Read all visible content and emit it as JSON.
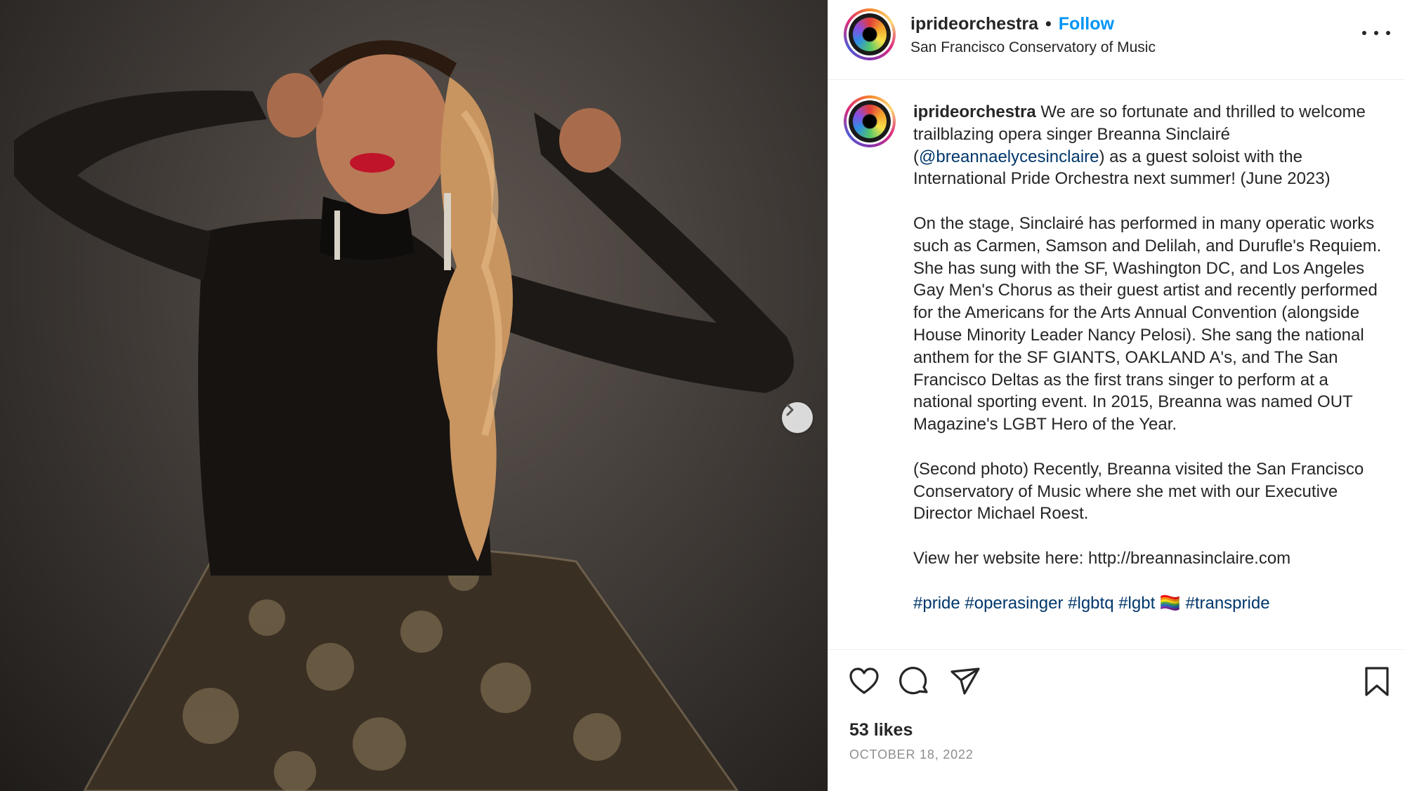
{
  "post": {
    "username": "iprideorchestra",
    "follow_label": "Follow",
    "location": "San Francisco Conservatory of Music",
    "caption": {
      "username": "iprideorchestra",
      "p1_a": "We are so fortunate and thrilled to welcome trailblazing opera singer Breanna Sinclairé (",
      "p1_mention": "@breannaelycesinclaire",
      "p1_b": ") as a guest soloist with the International Pride Orchestra next summer! (June 2023)",
      "p2": "On the stage, Sinclairé has performed in many operatic works such as Carmen, Samson and Delilah, and Durufle's Requiem. She has sung with the SF, Washington DC, and Los Angeles  Gay Men's Chorus as their guest artist and recently performed for the Americans for the Arts Annual Convention (alongside House Minority Leader Nancy Pelosi). She sang the national anthem for the SF GIANTS, OAKLAND A's, and The San Francisco Deltas as the first trans singer to perform at a national sporting event. In 2015, Breanna was named OUT Magazine's LGBT Hero of the Year.",
      "p3": "(Second photo) Recently, Breanna visited the San Francisco Conservatory of Music where she met with our Executive Director Michael Roest.",
      "p4": "View her website here: http://breannasinclaire.com",
      "hashtags": "#pride #operasinger #lgbtq #lgbt 🏳️‍🌈 #transpride"
    },
    "likes": "53 likes",
    "date": "OCTOBER 18, 2022"
  },
  "icons": {
    "like": "heart-icon",
    "comment": "comment-icon",
    "share": "share-icon",
    "save": "bookmark-icon",
    "more": "more-icon",
    "next": "chevron-right-icon"
  },
  "colors": {
    "accent": "#0095f6",
    "mention": "#00376b",
    "muted": "#8e8e8e"
  }
}
